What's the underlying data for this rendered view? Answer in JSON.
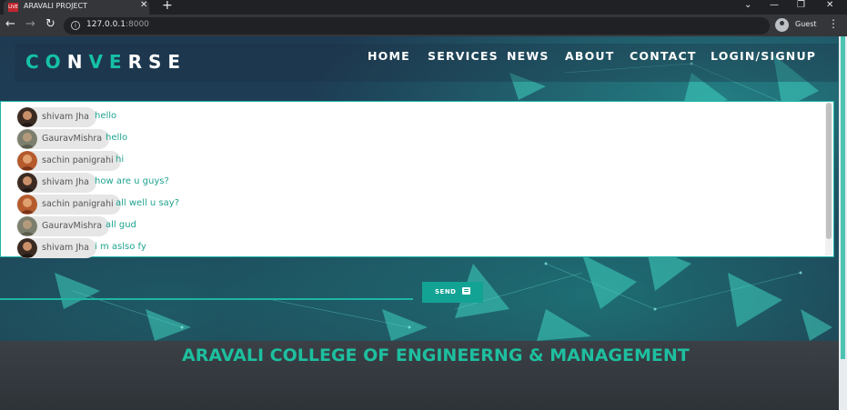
{
  "browser": {
    "tab_title": "ARAVALI PROJECT",
    "tab_favicon_text": "LIVE",
    "tab_close": "✕",
    "new_tab": "+",
    "url_host": "127.0.0.1",
    "url_port": ":8000",
    "profile_name": "Guest",
    "window_controls": {
      "minimize": "—",
      "restore": "❐",
      "close": "✕"
    },
    "nav": {
      "back": "←",
      "forward": "→",
      "reload": "↻",
      "menu": "⋮"
    }
  },
  "site": {
    "logo_parts": [
      "CO",
      "N",
      "VE",
      "RSE"
    ],
    "menu": [
      "HOME",
      "SERVICES",
      "NEWS",
      "ABOUT",
      "CONTACT",
      "LOGIN/SIGNUP"
    ]
  },
  "chat": {
    "messages": [
      {
        "user": "shivam Jha",
        "text": "hello",
        "avatar": "avatar-shivam"
      },
      {
        "user": "GauravMishra",
        "text": "hello",
        "avatar": "avatar-gaurav"
      },
      {
        "user": "sachin panigrahi",
        "text": "hi",
        "avatar": "avatar-sachin"
      },
      {
        "user": "shivam Jha",
        "text": "how are u guys?",
        "avatar": "avatar-shivam"
      },
      {
        "user": "sachin panigrahi",
        "text": "all well u say?",
        "avatar": "avatar-sachin"
      },
      {
        "user": "GauravMishra",
        "text": "all gud",
        "avatar": "avatar-gaurav"
      },
      {
        "user": "shivam Jha",
        "text": "i m aslso fy",
        "avatar": "avatar-shivam"
      }
    ],
    "send_label": "SEND"
  },
  "footer": {
    "title": "ARAVALI COLLEGE OF ENGINEERNG & MANAGEMENT"
  },
  "colors": {
    "accent": "#1fb5a6",
    "logo_accent": "#15c2a6",
    "send_button": "#13a394",
    "footer_title": "#1dbf9f"
  }
}
